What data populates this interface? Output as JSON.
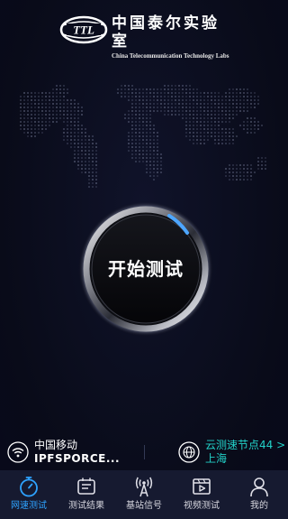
{
  "header": {
    "logo_mark_text": "TTL",
    "logo_cn": "中国泰尔实验室",
    "logo_en": "China Telecommunication Technology Labs"
  },
  "main": {
    "start_button_label": "开始测试"
  },
  "info": {
    "network_name": "中国移动",
    "network_sub": "IPFSPORCE...",
    "node_name": "云测速节点44 >",
    "node_city": "上海",
    "accent_color": "#22d1c8"
  },
  "nav": {
    "items": [
      {
        "label": "网速测试",
        "icon": "stopwatch-icon",
        "active": true
      },
      {
        "label": "测试结果",
        "icon": "results-icon",
        "active": false
      },
      {
        "label": "基站信号",
        "icon": "signal-tower-icon",
        "active": false
      },
      {
        "label": "视频测试",
        "icon": "video-icon",
        "active": false
      },
      {
        "label": "我的",
        "icon": "profile-icon",
        "active": false
      }
    ],
    "active_color": "#2ea3ff"
  }
}
